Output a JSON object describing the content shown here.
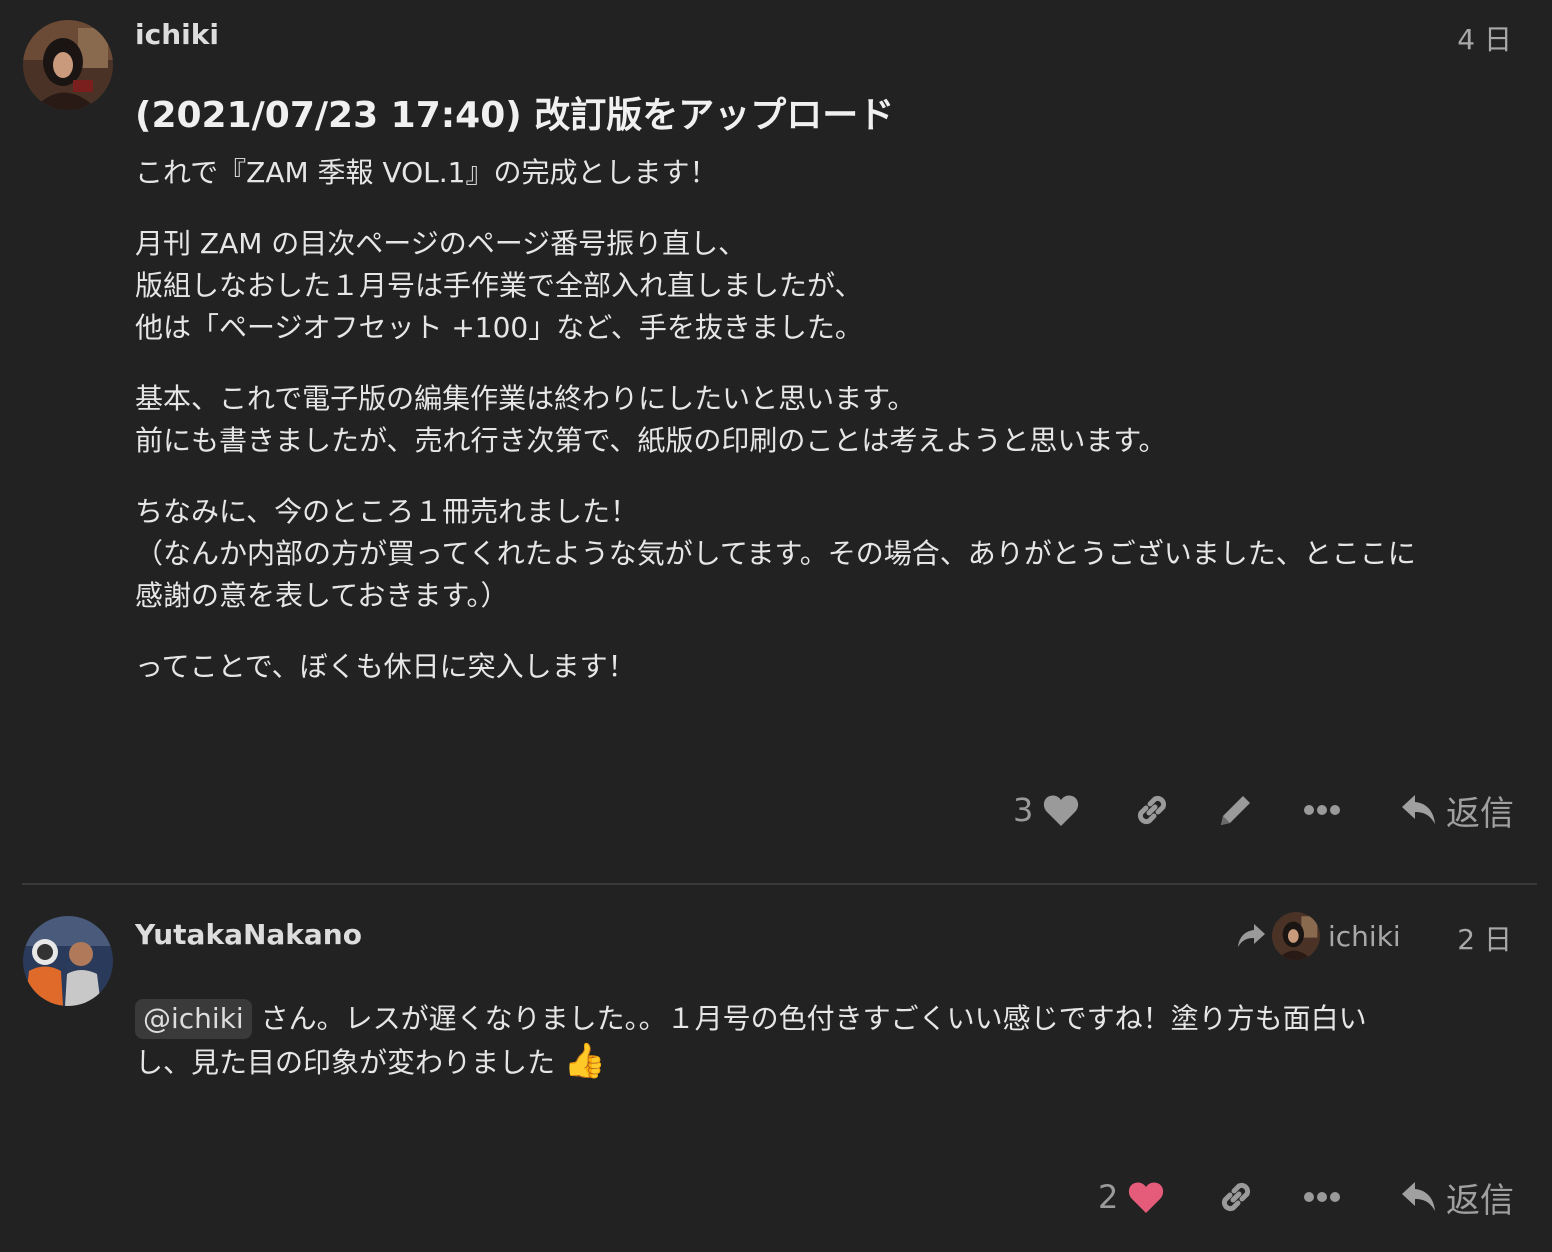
{
  "posts": [
    {
      "username": "ichiki",
      "date": "4 日",
      "title": "(2021/07/23 17:40) 改訂版をアップロード",
      "paragraphs": [
        [
          "これで『ZAM 季報 VOL.1』の完成とします！"
        ],
        [
          "月刊 ZAM の目次ページのページ番号振り直し、",
          "版組しなおした１月号は手作業で全部入れ直しましたが、",
          "他は「ページオフセット +100」など、手を抜きました。"
        ],
        [
          "基本、これで電子版の編集作業は終わりにしたいと思います。",
          "前にも書きましたが、売れ行き次第で、紙版の印刷のことは考えようと思います。"
        ],
        [
          "ちなみに、今のところ１冊売れました！",
          "（なんか内部の方が買ってくれたような気がしてます。その場合、ありがとうございました、とここに",
          "感謝の意を表しておきます。）"
        ],
        [
          "ってことで、ぼくも休日に突入します！"
        ]
      ],
      "like_count": "3",
      "reply_label": "返信",
      "icons": [
        "heart-icon",
        "link-icon",
        "pencil-icon",
        "more-icon",
        "reply-icon"
      ]
    },
    {
      "username": "YutakaNakano",
      "date": "2 日",
      "reply_to_user": "ichiki",
      "mention": "@ichiki",
      "body_line1": " さん。レスが遅くなりました。。１月号の色付きすごくいい感じですね！塗り方も面白い",
      "body_line2": "し、見た目の印象が変わりました",
      "emoji": "👍",
      "like_count": "2",
      "reply_label": "返信",
      "icons": [
        "heart-icon",
        "link-icon",
        "more-icon",
        "reply-icon"
      ]
    }
  ],
  "colors": {
    "background": "#222222",
    "text": "#dddddd",
    "muted": "#9a9a9a",
    "liked_heart": "#e45c7a"
  }
}
